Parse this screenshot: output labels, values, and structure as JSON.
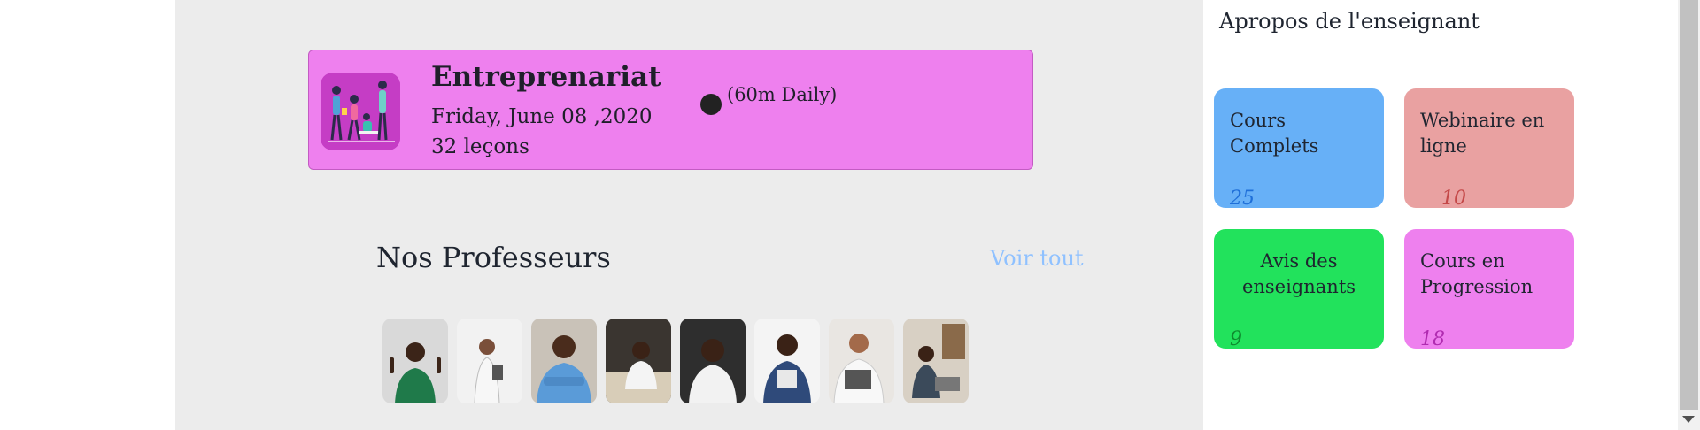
{
  "course": {
    "title": "Entreprenariat",
    "date": "Friday, June 08 ,2020",
    "lessons": "32 leçons",
    "duration": "(60m Daily)",
    "thumbnail_icon": "people-illustration-icon",
    "colors": {
      "card": "#ee80ee",
      "thumb": "#c53dc5"
    }
  },
  "teachers": {
    "title": "Nos Professeurs",
    "see_all": "Voir tout",
    "avatars": [
      {
        "icon": "teacher-avatar-1"
      },
      {
        "icon": "teacher-avatar-2"
      },
      {
        "icon": "teacher-avatar-3"
      },
      {
        "icon": "teacher-avatar-4"
      },
      {
        "icon": "teacher-avatar-5"
      },
      {
        "icon": "teacher-avatar-6"
      },
      {
        "icon": "teacher-avatar-7"
      },
      {
        "icon": "teacher-avatar-8"
      }
    ]
  },
  "sidebar": {
    "title": "Apropos de l'enseignant",
    "stats": [
      {
        "label": "Cours Complets",
        "count": "25",
        "color": "#67b0f7",
        "count_color": "#1f6fd8"
      },
      {
        "label": "Webinaire en ligne",
        "count": "10",
        "color": "#e9a1a1",
        "count_color": "#c44848"
      },
      {
        "label": "Avis des enseignants",
        "count": "9",
        "color": "#22e25c",
        "count_color": "#0e8a2e"
      },
      {
        "label": "Cours en Progression",
        "count": "18",
        "color": "#ee80ee",
        "count_color": "#b02cb0"
      }
    ]
  }
}
